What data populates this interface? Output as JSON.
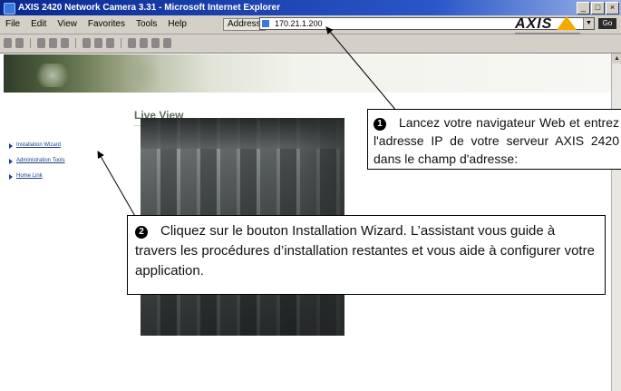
{
  "browser": {
    "title": "AXIS 2420 Network Camera 3.31 - Microsoft Internet Explorer",
    "menu": [
      "File",
      "Edit",
      "View",
      "Favorites",
      "Tools",
      "Help"
    ],
    "address_label": "Address",
    "address_value": "170.21.1.200",
    "go_label": "Go"
  },
  "page": {
    "logo_text": "AXIS",
    "heading": "Live View",
    "nav_links": [
      "Installation Wizard",
      "Administration Tools",
      "Home Link"
    ]
  },
  "callouts": {
    "step1": {
      "number": "❶",
      "text": "Lancez votre navigateur Web et entrez l'adresse IP de votre serveur AXIS 2420 dans le champ d'adresse:"
    },
    "step2": {
      "number": "❷",
      "text": "Cliquez sur le bouton Installation Wizard. L’assistant vous guide à travers les procédures d’installation restantes et vous aide à configurer votre application."
    }
  }
}
